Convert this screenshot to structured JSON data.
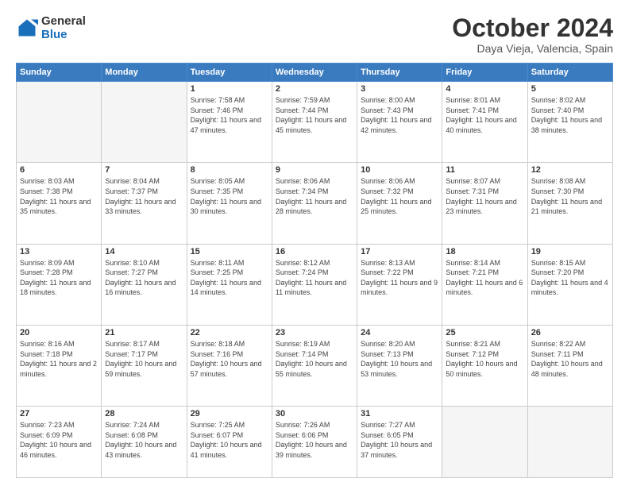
{
  "logo": {
    "line1": "General",
    "line2": "Blue"
  },
  "header": {
    "title": "October 2024",
    "subtitle": "Daya Vieja, Valencia, Spain"
  },
  "weekdays": [
    "Sunday",
    "Monday",
    "Tuesday",
    "Wednesday",
    "Thursday",
    "Friday",
    "Saturday"
  ],
  "weeks": [
    [
      {
        "day": "",
        "info": ""
      },
      {
        "day": "",
        "info": ""
      },
      {
        "day": "1",
        "info": "Sunrise: 7:58 AM\nSunset: 7:46 PM\nDaylight: 11 hours and 47 minutes."
      },
      {
        "day": "2",
        "info": "Sunrise: 7:59 AM\nSunset: 7:44 PM\nDaylight: 11 hours and 45 minutes."
      },
      {
        "day": "3",
        "info": "Sunrise: 8:00 AM\nSunset: 7:43 PM\nDaylight: 11 hours and 42 minutes."
      },
      {
        "day": "4",
        "info": "Sunrise: 8:01 AM\nSunset: 7:41 PM\nDaylight: 11 hours and 40 minutes."
      },
      {
        "day": "5",
        "info": "Sunrise: 8:02 AM\nSunset: 7:40 PM\nDaylight: 11 hours and 38 minutes."
      }
    ],
    [
      {
        "day": "6",
        "info": "Sunrise: 8:03 AM\nSunset: 7:38 PM\nDaylight: 11 hours and 35 minutes."
      },
      {
        "day": "7",
        "info": "Sunrise: 8:04 AM\nSunset: 7:37 PM\nDaylight: 11 hours and 33 minutes."
      },
      {
        "day": "8",
        "info": "Sunrise: 8:05 AM\nSunset: 7:35 PM\nDaylight: 11 hours and 30 minutes."
      },
      {
        "day": "9",
        "info": "Sunrise: 8:06 AM\nSunset: 7:34 PM\nDaylight: 11 hours and 28 minutes."
      },
      {
        "day": "10",
        "info": "Sunrise: 8:06 AM\nSunset: 7:32 PM\nDaylight: 11 hours and 25 minutes."
      },
      {
        "day": "11",
        "info": "Sunrise: 8:07 AM\nSunset: 7:31 PM\nDaylight: 11 hours and 23 minutes."
      },
      {
        "day": "12",
        "info": "Sunrise: 8:08 AM\nSunset: 7:30 PM\nDaylight: 11 hours and 21 minutes."
      }
    ],
    [
      {
        "day": "13",
        "info": "Sunrise: 8:09 AM\nSunset: 7:28 PM\nDaylight: 11 hours and 18 minutes."
      },
      {
        "day": "14",
        "info": "Sunrise: 8:10 AM\nSunset: 7:27 PM\nDaylight: 11 hours and 16 minutes."
      },
      {
        "day": "15",
        "info": "Sunrise: 8:11 AM\nSunset: 7:25 PM\nDaylight: 11 hours and 14 minutes."
      },
      {
        "day": "16",
        "info": "Sunrise: 8:12 AM\nSunset: 7:24 PM\nDaylight: 11 hours and 11 minutes."
      },
      {
        "day": "17",
        "info": "Sunrise: 8:13 AM\nSunset: 7:22 PM\nDaylight: 11 hours and 9 minutes."
      },
      {
        "day": "18",
        "info": "Sunrise: 8:14 AM\nSunset: 7:21 PM\nDaylight: 11 hours and 6 minutes."
      },
      {
        "day": "19",
        "info": "Sunrise: 8:15 AM\nSunset: 7:20 PM\nDaylight: 11 hours and 4 minutes."
      }
    ],
    [
      {
        "day": "20",
        "info": "Sunrise: 8:16 AM\nSunset: 7:18 PM\nDaylight: 11 hours and 2 minutes."
      },
      {
        "day": "21",
        "info": "Sunrise: 8:17 AM\nSunset: 7:17 PM\nDaylight: 10 hours and 59 minutes."
      },
      {
        "day": "22",
        "info": "Sunrise: 8:18 AM\nSunset: 7:16 PM\nDaylight: 10 hours and 57 minutes."
      },
      {
        "day": "23",
        "info": "Sunrise: 8:19 AM\nSunset: 7:14 PM\nDaylight: 10 hours and 55 minutes."
      },
      {
        "day": "24",
        "info": "Sunrise: 8:20 AM\nSunset: 7:13 PM\nDaylight: 10 hours and 53 minutes."
      },
      {
        "day": "25",
        "info": "Sunrise: 8:21 AM\nSunset: 7:12 PM\nDaylight: 10 hours and 50 minutes."
      },
      {
        "day": "26",
        "info": "Sunrise: 8:22 AM\nSunset: 7:11 PM\nDaylight: 10 hours and 48 minutes."
      }
    ],
    [
      {
        "day": "27",
        "info": "Sunrise: 7:23 AM\nSunset: 6:09 PM\nDaylight: 10 hours and 46 minutes."
      },
      {
        "day": "28",
        "info": "Sunrise: 7:24 AM\nSunset: 6:08 PM\nDaylight: 10 hours and 43 minutes."
      },
      {
        "day": "29",
        "info": "Sunrise: 7:25 AM\nSunset: 6:07 PM\nDaylight: 10 hours and 41 minutes."
      },
      {
        "day": "30",
        "info": "Sunrise: 7:26 AM\nSunset: 6:06 PM\nDaylight: 10 hours and 39 minutes."
      },
      {
        "day": "31",
        "info": "Sunrise: 7:27 AM\nSunset: 6:05 PM\nDaylight: 10 hours and 37 minutes."
      },
      {
        "day": "",
        "info": ""
      },
      {
        "day": "",
        "info": ""
      }
    ]
  ]
}
